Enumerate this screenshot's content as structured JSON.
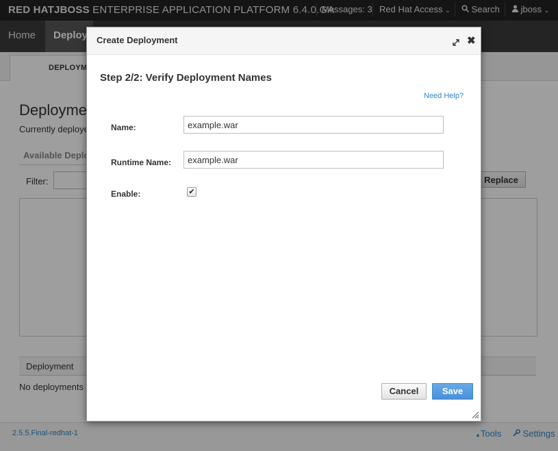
{
  "header": {
    "brand_redhat": "RED HAT",
    "brand_jboss": "JBOSS",
    "brand_product": " ENTERPRISE APPLICATION PLATFORM",
    "version": "6.4.0.GA",
    "messages": "Messages: 3",
    "redhat_access": "Red Hat Access",
    "search": "Search",
    "user": "jboss"
  },
  "nav": {
    "home": "Home",
    "deployments": "Deploy"
  },
  "page": {
    "subtab": "DEPLOYME",
    "title": "Deploymen",
    "subtitle": "Currently deploye",
    "available": "Available Deplo",
    "filter_label": "Filter:",
    "replace_label": "Replace",
    "column_deployment": "Deployment",
    "no_deployments": "No deployments a"
  },
  "modal": {
    "title": "Create Deployment",
    "step_title": "Step 2/2: Verify Deployment Names",
    "help_link": "Need Help?",
    "name_label": "Name:",
    "name_value": "example.war",
    "runtime_label": "Runtime Name:",
    "runtime_value": "example.war",
    "enable_label": "Enable:",
    "enable_checked": true,
    "cancel_label": "Cancel",
    "save_label": "Save"
  },
  "footer": {
    "version": "2.5.5.Final-redhat-1",
    "tools": "Tools",
    "settings": "Settings"
  },
  "colors": {
    "topbar": "#232323",
    "nav": "#3a3a3a",
    "link": "#2e86c1",
    "primary_button": "#4a90d9"
  }
}
